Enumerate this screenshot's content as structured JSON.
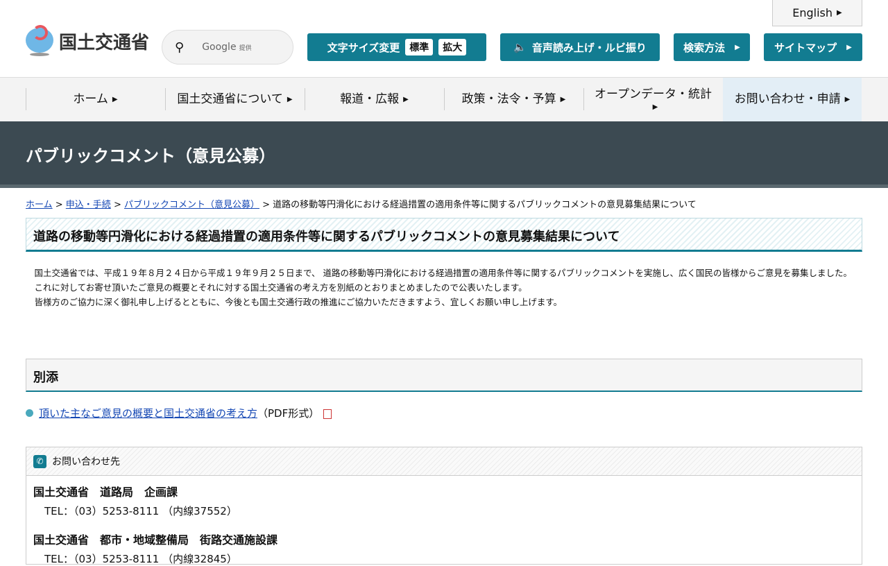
{
  "header": {
    "logo_text": "国土交通省",
    "search": {
      "provider": "Google",
      "provided": "提供"
    },
    "english": "English",
    "font_size": {
      "label": "文字サイズ変更",
      "standard": "標準",
      "large": "拡大"
    },
    "speech": "音声読み上げ・ルビ振り",
    "search_method": "検索方法",
    "sitemap": "サイトマップ"
  },
  "nav": [
    "ホーム",
    "国土交通省について",
    "報道・広報",
    "政策・法令・予算",
    "オープンデータ・統計",
    "お問い合わせ・申請"
  ],
  "banner": "パブリックコメント（意見公募）",
  "breadcrumb": {
    "home": "ホーム",
    "apply": "申込・手続",
    "pubcom": "パブリックコメント（意見公募）",
    "current": "道路の移動等円滑化における経過措置の適用条件等に関するパブリックコメントの意見募集結果について"
  },
  "title": "道路の移動等円滑化における経過措置の適用条件等に関するパブリックコメントの意見募集結果について",
  "paragraphs": [
    "　国土交通省では、平成１９年８月２４日から平成１９年９月２５日まで、 道路の移動等円滑化における経過措置の適用条件等に関するパブリックコメントを実施し、広く国民の皆様からご意見を募集しました。",
    "　これに対してお寄せ頂いたご意見の概要とそれに対する国土交通省の考え方を別紙のとおりまとめましたので公表いたします。",
    "　皆様方のご協力に深く御礼申し上げるとともに、今後とも国土交通行政の推進にご協力いただきますよう、宜しくお願い申し上げます。"
  ],
  "attachments": {
    "heading": "別添",
    "link": "頂いた主なご意見の概要と国土交通省の考え方",
    "format": "（PDF形式）"
  },
  "contact": {
    "heading": "お問い合わせ先",
    "entries": [
      {
        "org": "国土交通省　道路局　企画課",
        "tel": "TEL：（03）5253-8111 （内線37552）"
      },
      {
        "org": "国土交通省　都市・地域整備局　街路交通施設課",
        "tel": "TEL：（03）5253-8111 （内線32845）"
      }
    ]
  }
}
